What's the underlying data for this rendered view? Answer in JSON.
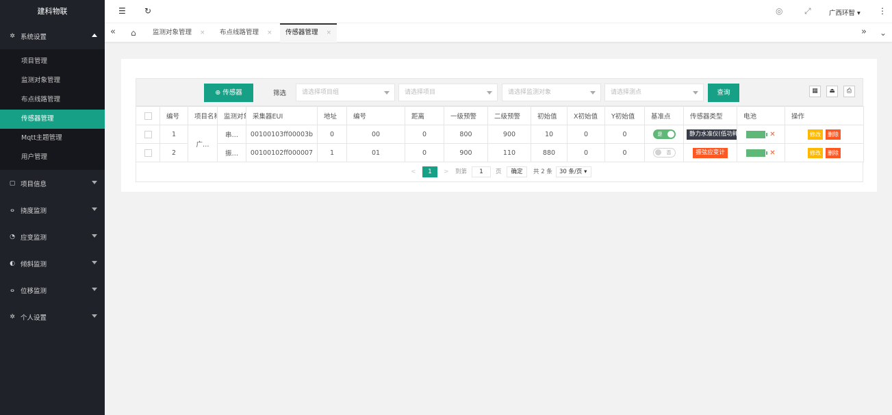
{
  "brand": "建科物联",
  "sidebar": {
    "system": {
      "label": "系统设置",
      "items": [
        "项目管理",
        "监测对象管理",
        "布点线路管理",
        "传感器管理",
        "Mqtt主题管理",
        "用户管理"
      ],
      "active": "传感器管理"
    },
    "groups": [
      {
        "label": "项目信息",
        "icon": "doc-icon",
        "glyph": "▢"
      },
      {
        "label": "挠度监测",
        "icon": "curve-icon",
        "glyph": "ⴰ"
      },
      {
        "label": "应变监测",
        "icon": "strain-icon",
        "glyph": "◔"
      },
      {
        "label": "倾斜监测",
        "icon": "tilt-icon",
        "glyph": "◐"
      },
      {
        "label": "位移监测",
        "icon": "move-icon",
        "glyph": "ⴰ"
      },
      {
        "label": "个人设置",
        "icon": "gear-icon",
        "glyph": "✲"
      }
    ]
  },
  "topbar": {
    "user": "广西环智",
    "user_caret": "▾",
    "menu": "⋮"
  },
  "tabs": {
    "left_nav": "«",
    "home": "⌂",
    "right_nav": "»",
    "more": "⌄",
    "items": [
      {
        "label": "监测对象管理",
        "close": "×"
      },
      {
        "label": "布点线路管理",
        "close": "×"
      },
      {
        "label": "传感器管理",
        "close": "×"
      }
    ]
  },
  "toolbar": {
    "add_label": "⊕ 传感器",
    "filter_label": "筛选",
    "selects": [
      "请选择项目组",
      "请选择项目",
      "请选择监测对象",
      "请选择测点"
    ],
    "query_label": "查询"
  },
  "table": {
    "headers": [
      "编号",
      "项目名称",
      "监测对象",
      "采集器EUI",
      "地址",
      "编号",
      "距离",
      "一级预警",
      "二级预警",
      "初始值",
      "X初始值",
      "Y初始值",
      "基准点",
      "传感器类型",
      "电池",
      "操作"
    ],
    "project_merged": "广…",
    "rows": [
      {
        "no": "1",
        "object": "串…",
        "eui": "00100103ff00003b",
        "addr": "0",
        "code": "00",
        "dist": "0",
        "warn1": "800",
        "warn2": "900",
        "init": "10",
        "xinit": "0",
        "yinit": "0",
        "base": "是",
        "base_on": true,
        "type": "静力水准仪(低功耗)",
        "type_color": "#393d49"
      },
      {
        "no": "2",
        "object": "振…",
        "eui": "00100102ff000007",
        "addr": "1",
        "code": "01",
        "dist": "0",
        "warn1": "900",
        "warn2": "110",
        "init": "880",
        "xinit": "0",
        "yinit": "0",
        "base": "否",
        "base_on": false,
        "type": "振弦应变计",
        "type_color": "#ff5722"
      }
    ],
    "battery_level": 1.0,
    "battery_mark": "✕",
    "edit_label": "修改",
    "delete_label": "删除"
  },
  "pager": {
    "current": "1",
    "goto_label": "到第",
    "goto_value": "1",
    "page_unit": "页",
    "confirm": "确定",
    "total": "共 2 条",
    "per_page": "30 条/页",
    "prev": "<",
    "next": ">"
  },
  "colors": {
    "accent": "#16a085",
    "sidebar": "#20222a",
    "danger": "#ff5722",
    "warn": "#ffb800",
    "dark": "#393d49"
  }
}
